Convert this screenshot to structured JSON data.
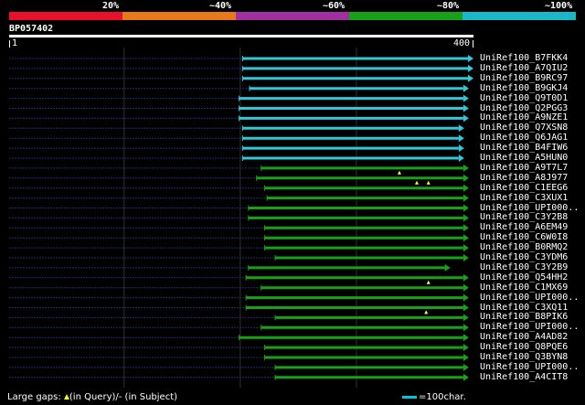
{
  "scale": {
    "labels": [
      "20%",
      "~40%",
      "~60%",
      "~80%",
      "~100%"
    ],
    "segments": [
      {
        "color": "#e8102a"
      },
      {
        "color": "#e87818"
      },
      {
        "color": "#a030a0"
      },
      {
        "color": "#18a018"
      },
      {
        "color": "#18b8c8"
      }
    ]
  },
  "query": {
    "id": "BP057402",
    "length": 400,
    "start_label": "1",
    "end_label": "400"
  },
  "colors": {
    "cyan": "#30c8d8",
    "green": "#18a018",
    "dotted": "#202a70",
    "tick": "#ffff40",
    "grid": "#303030"
  },
  "hits": [
    {
      "name": "UniRef100_B7FKK4",
      "start": 202,
      "end": 400,
      "color": "cyan"
    },
    {
      "name": "UniRef100_A7QIU2",
      "start": 202,
      "end": 400,
      "color": "cyan"
    },
    {
      "name": "UniRef100_B9RC97",
      "start": 202,
      "end": 400,
      "color": "cyan"
    },
    {
      "name": "UniRef100_B9GKJ4",
      "start": 208,
      "end": 396,
      "color": "cyan"
    },
    {
      "name": "UniRef100_Q9T0D1",
      "start": 199,
      "end": 396,
      "color": "cyan"
    },
    {
      "name": "UniRef100_Q2PGG3",
      "start": 199,
      "end": 396,
      "color": "cyan"
    },
    {
      "name": "UniRef100_A9NZE1",
      "start": 199,
      "end": 396,
      "color": "cyan"
    },
    {
      "name": "UniRef100_Q7XSN8",
      "start": 202,
      "end": 392,
      "color": "cyan"
    },
    {
      "name": "UniRef100_Q6JAG1",
      "start": 202,
      "end": 392,
      "color": "cyan"
    },
    {
      "name": "UniRef100_B4FIW6",
      "start": 202,
      "end": 392,
      "color": "cyan"
    },
    {
      "name": "UniRef100_A5HUN0",
      "start": 202,
      "end": 392,
      "color": "cyan"
    },
    {
      "name": "UniRef100_A9T7L7",
      "start": 218,
      "end": 396,
      "color": "green"
    },
    {
      "name": "UniRef100_A8J977",
      "start": 214,
      "end": 396,
      "color": "green",
      "query_gaps": [
        337
      ]
    },
    {
      "name": "UniRef100_C1EEG6",
      "start": 221,
      "end": 396,
      "color": "green",
      "query_gaps": [
        352,
        362
      ]
    },
    {
      "name": "UniRef100_C3XUX1",
      "start": 223,
      "end": 396,
      "color": "green"
    },
    {
      "name": "UniRef100_UPI000..",
      "start": 207,
      "end": 396,
      "color": "green"
    },
    {
      "name": "UniRef100_C3Y2B8",
      "start": 207,
      "end": 396,
      "color": "green"
    },
    {
      "name": "UniRef100_A6EM49",
      "start": 221,
      "end": 396,
      "color": "green"
    },
    {
      "name": "UniRef100_C6W0I8",
      "start": 221,
      "end": 396,
      "color": "green"
    },
    {
      "name": "UniRef100_B0RMQ2",
      "start": 221,
      "end": 396,
      "color": "green"
    },
    {
      "name": "UniRef100_C3YDM6",
      "start": 230,
      "end": 396,
      "color": "green"
    },
    {
      "name": "UniRef100_C3Y2B9",
      "start": 207,
      "end": 380,
      "color": "green"
    },
    {
      "name": "UniRef100_Q54HH2",
      "start": 205,
      "end": 396,
      "color": "green"
    },
    {
      "name": "UniRef100_C1MX69",
      "start": 218,
      "end": 396,
      "color": "green",
      "query_gaps": [
        362
      ]
    },
    {
      "name": "UniRef100_UPI000..",
      "start": 205,
      "end": 396,
      "color": "green"
    },
    {
      "name": "UniRef100_C3XQ11",
      "start": 205,
      "end": 396,
      "color": "green"
    },
    {
      "name": "UniRef100_B8PIK6",
      "start": 230,
      "end": 396,
      "color": "green",
      "query_gaps": [
        360
      ]
    },
    {
      "name": "UniRef100_UPI000..",
      "start": 218,
      "end": 396,
      "color": "green"
    },
    {
      "name": "UniRef100_A4AD82",
      "start": 199,
      "end": 396,
      "color": "green"
    },
    {
      "name": "UniRef100_Q8PQE6",
      "start": 221,
      "end": 396,
      "color": "green"
    },
    {
      "name": "UniRef100_Q3BYN8",
      "start": 221,
      "end": 396,
      "color": "green"
    },
    {
      "name": "UniRef100_UPI000..",
      "start": 230,
      "end": 396,
      "color": "green"
    },
    {
      "name": "UniRef100_A4CIT8",
      "start": 230,
      "end": 396,
      "color": "green"
    }
  ],
  "legend": {
    "gaps_prefix": "Large gaps:",
    "gaps_query": "(in Query)/",
    "gaps_subject": "- (in Subject)",
    "scale_text": "=100char."
  }
}
